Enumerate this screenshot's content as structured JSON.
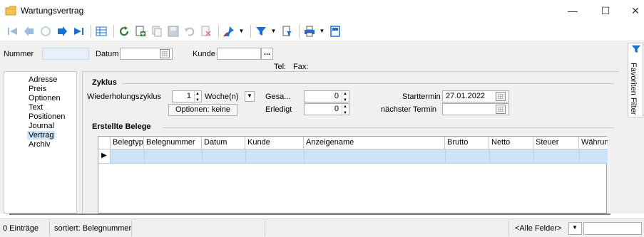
{
  "window": {
    "title": "Wartungsvertrag",
    "minimize": "—",
    "maximize": "☐",
    "close": "✕"
  },
  "header": {
    "nummer_label": "Nummer",
    "nummer_value": "",
    "datum_label": "Datum",
    "datum_value": "",
    "kunde_label": "Kunde",
    "kunde_value": "",
    "kunde_btn": "...",
    "tel_label": "Tel:",
    "fax_label": "Fax:"
  },
  "nav": {
    "items": [
      "Adresse",
      "Preis",
      "Optionen",
      "Text",
      "Positionen",
      "Journal",
      "Vertrag",
      "Archiv"
    ],
    "selected": "Vertrag"
  },
  "zyklus": {
    "title": "Zyklus",
    "wiederholung_label": "Wiederholungszyklus",
    "wiederholung_value": "1",
    "einheit": "Woche(n)",
    "optionen_button": "Optionen: keine",
    "gesamt_label": "Gesa...",
    "gesamt_value": "0",
    "erledigt_label": "Erledigt",
    "erledigt_value": "0",
    "starttermin_label": "Starttermin",
    "starttermin_value": "27.01.2022",
    "naechster_label": "nächster Termin",
    "naechster_value": ""
  },
  "belege": {
    "title": "Erstellte Belege",
    "columns": [
      "Belegtyp",
      "Belegnummer",
      "Datum",
      "Kunde",
      "Anzeigename",
      "Brutto",
      "Netto",
      "Steuer",
      "Währung"
    ],
    "row_marker": "▶"
  },
  "dock": {
    "label": "Favoriten Filter"
  },
  "status": {
    "count": "0 Einträge",
    "sort": "sortiert: Belegnummer",
    "filter_field": "<Alle Felder>"
  },
  "colors": {
    "accent": "#1a6fd0",
    "selection": "#cde3f7",
    "input_blue": "#e8f1fb"
  }
}
